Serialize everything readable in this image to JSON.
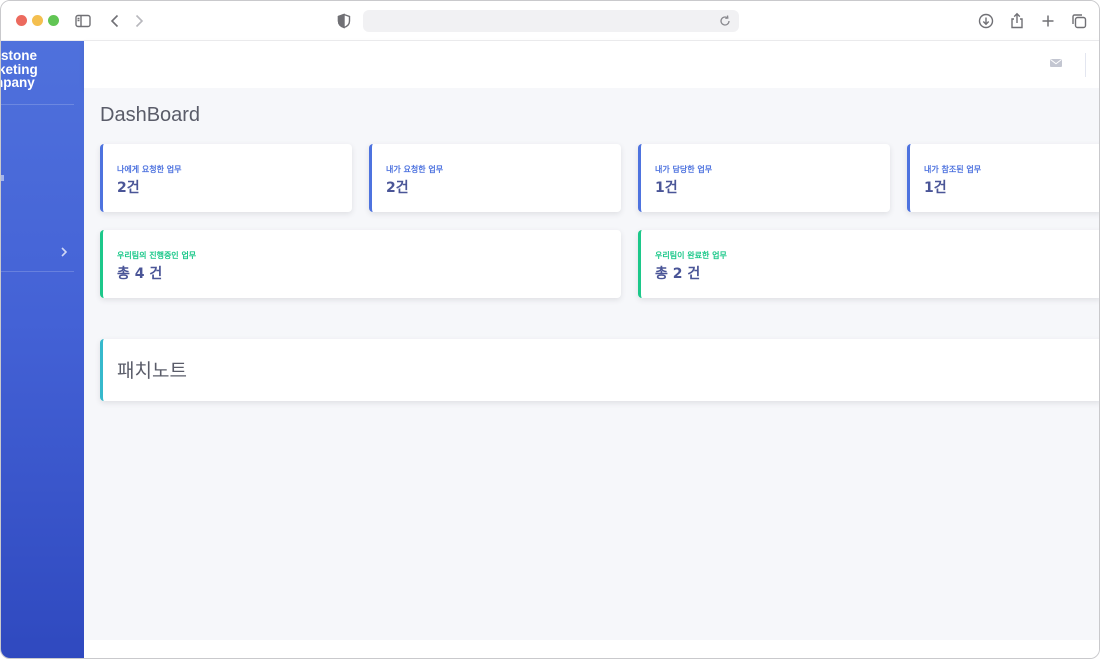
{
  "browser": {
    "url": "",
    "icons": [
      "sidebar-toggle-icon",
      "back-icon",
      "forward-icon",
      "shield-icon",
      "reload-icon",
      "download-icon",
      "share-icon",
      "new-tab-icon",
      "tabs-overview-icon"
    ]
  },
  "sidebar": {
    "brand_lines": [
      "stone",
      "keting",
      "npany"
    ],
    "chevron_icon": "chevron-right-icon"
  },
  "topbar": {
    "mail_icon": "envelope-icon"
  },
  "page": {
    "title": "DashBoard"
  },
  "stats": [
    {
      "label": "나에게 요청한 업무",
      "value": "2건",
      "accent": "#4e73df"
    },
    {
      "label": "내가 요청한 업무",
      "value": "2건",
      "accent": "#4e73df"
    },
    {
      "label": "내가 담당한 업무",
      "value": "1건",
      "accent": "#4e73df"
    },
    {
      "label": "내가 참조된 업무",
      "value": "1건",
      "accent": "#4e73df"
    }
  ],
  "team_stats": [
    {
      "label": "우리팀의 진행중인 업무",
      "value": "총 4 건",
      "accent": "#1cc88a"
    },
    {
      "label": "우리팀이 완료한 업무",
      "value": "총 2 건",
      "accent": "#1cc88a"
    }
  ],
  "patch_notes": {
    "title": "패치노트",
    "accent": "#36b9cc"
  }
}
